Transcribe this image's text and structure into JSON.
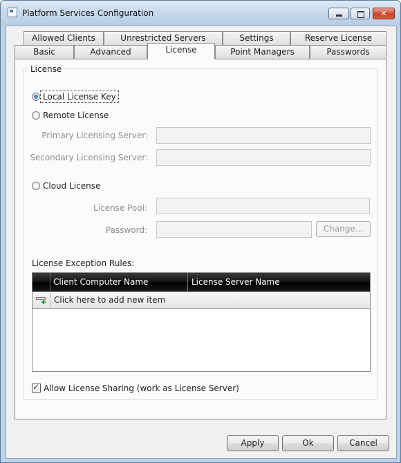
{
  "window": {
    "title": "Platform Services Configuration"
  },
  "tabs": {
    "row1": [
      "Allowed Clients",
      "Unrestricted Servers",
      "Settings",
      "Reserve License"
    ],
    "row2": [
      "Basic",
      "Advanced",
      "License",
      "Point Managers",
      "Passwords"
    ],
    "active": "License"
  },
  "license": {
    "group_title": "License",
    "local_label": "Local License Key",
    "remote_label": "Remote License",
    "primary_label": "Primary Licensing Server:",
    "secondary_label": "Secondary Licensing Server:",
    "cloud_label": "Cloud License",
    "pool_label": "License Pool:",
    "password_label": "Password:",
    "change_button": "Change...",
    "selected": "Local License Key"
  },
  "exceptions": {
    "label": "License Exception Rules:",
    "columns": [
      "Client Computer Name",
      "License Server Name"
    ],
    "add_row_text": "Click here to add new item"
  },
  "sharing": {
    "label": "Allow License Sharing (work as License Server)",
    "checked": true
  },
  "footer": {
    "apply": "Apply",
    "ok": "Ok",
    "cancel": "Cancel"
  },
  "icons": [
    "app-icon",
    "minimize-icon",
    "maximize-icon",
    "close-icon",
    "add-row-icon"
  ]
}
